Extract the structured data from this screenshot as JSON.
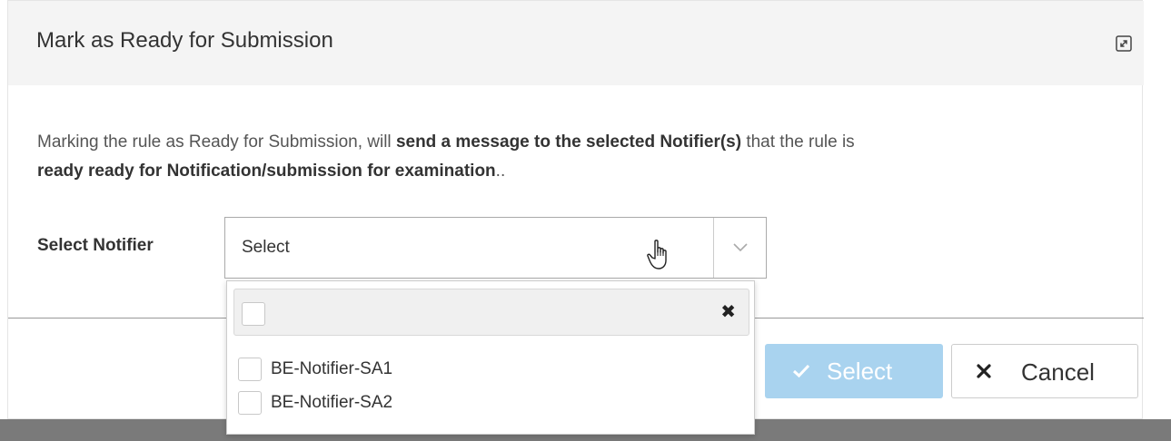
{
  "dialog": {
    "title": "Mark as Ready for Submission",
    "message": {
      "part1": "Marking the rule as Ready for Submission, will ",
      "bold1": "send a message to the selected Notifier(s)",
      "part2": " that the rule is",
      "bold2": "ready ready for Notification/submission for examination",
      "part3": ".."
    },
    "field_label": "Select Notifier",
    "select_placeholder": "Select",
    "dropdown": {
      "clear_symbol": "✖",
      "options": [
        {
          "label": "BE-Notifier-SA1",
          "checked": false
        },
        {
          "label": "BE-Notifier-SA2",
          "checked": false
        }
      ]
    },
    "buttons": {
      "select_label": "Select",
      "cancel_label": "Cancel"
    }
  },
  "icons": {
    "expand": "expand-icon",
    "chevron": "chevron-down-icon",
    "cursor": "hand-pointer-icon",
    "check": "check-icon",
    "close": "close-icon"
  },
  "colors": {
    "select_button_bg": "#a9d3ef",
    "header_bg": "#f4f4f4",
    "backdrop": "#7a7a7a"
  }
}
